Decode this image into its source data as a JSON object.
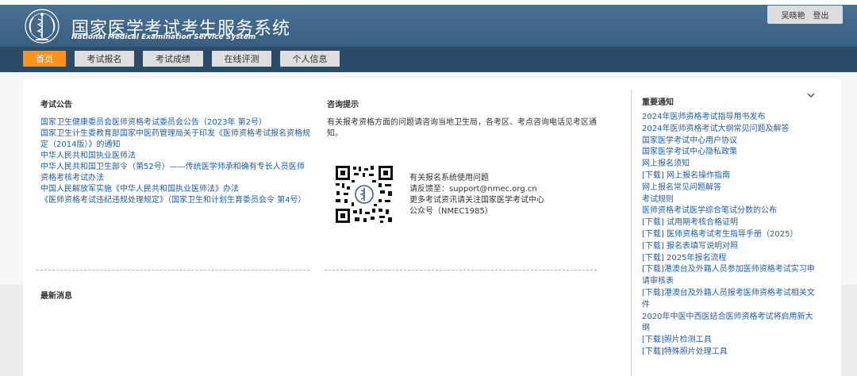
{
  "header": {
    "title": "国家医学考试考生服务系统",
    "subtitle": "National Medical Examination Service System"
  },
  "user": {
    "name": "吴晓艳",
    "logout_label": "登出"
  },
  "nav": {
    "items": [
      "首页",
      "考试报名",
      "考试成绩",
      "在线评测",
      "个人信息"
    ],
    "active": "首页"
  },
  "announcements": {
    "title": "考试公告",
    "items": [
      "国家卫生健康委员会医师资格考试委员会公告（2023年 第2号）",
      "国家卫生计生委教育部国家中医药管理局关于印发《医师资格考试报名资格规定（2014版）》的通知",
      "中华人民共和国执业医师法",
      "中华人民共和国卫生部令（第52号）——传统医学师承和确有专长人员医师资格考核考试办法",
      "中国人民解放军实施《中华人民共和国执业医师法》办法",
      "《医师资格考试违纪违规处理规定》（国家卫生和计划生育委员会令 第4号）"
    ]
  },
  "consult": {
    "title": "咨询提示",
    "text": "有关报考资格方面的问题请咨询当地卫生局，各考区、考点咨询电话见考区通知。",
    "contact_lines": [
      "有关报名系统使用问题",
      "请反馈至：support@nmec.org.cn",
      "更多考试资讯请关注国家医学考试中心",
      "公众号（NMEC1985）"
    ]
  },
  "news": {
    "title": "最新消息"
  },
  "notices": {
    "title": "重要通知",
    "items": [
      "2024年医师资格考试指导用书发布",
      "2024年医师资格考试大纲常见问题及解答",
      "国家医学考试中心用户协议",
      "国家医学考试中心隐私政策",
      "网上报名须知",
      "[下载] 网上报名操作指南",
      "网上报名常见问题解答",
      "考试规则",
      "医师资格考试医学综合笔试分数的公布",
      "[下载] 试用期考核合格证明",
      "[下载] 医师资格考试考生指导手册（2025）",
      "[下载] 报名表填写说明对照",
      "[下载] 2025年报名流程",
      "[下载]港澳台及外籍人员参加医师资格考试实习申请审核表",
      "[下载]港澳台及外籍人员报考医师资格考试相关文件",
      "2020年中医中西医结合医师资格考试将启用新大纲",
      "[下载]照片检测工具",
      "[下载]特殊照片处理工具"
    ]
  },
  "icons": {
    "logo": "medical-emblem-icon",
    "qr": "qr-code-icon",
    "collapse": "chevron-down-icon"
  },
  "colors": {
    "header": "#3b6183",
    "navbar": "#2b4c68",
    "active_tab": "#f7931e",
    "link": "#1f5ea8"
  }
}
